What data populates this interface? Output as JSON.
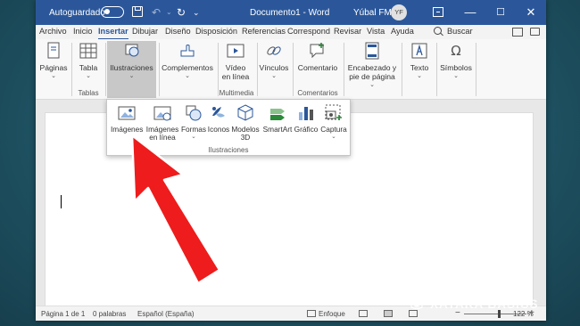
{
  "titlebar": {
    "autosave_label": "Autoguardado",
    "document_title": "Documento1 - Word",
    "user_name": "Yúbal FM",
    "user_initials": "YF",
    "minimize": "—",
    "maximize": "☐",
    "close": "✕"
  },
  "tabs": [
    "Archivo",
    "Inicio",
    "Insertar",
    "Dibujar",
    "Diseño",
    "Disposición",
    "Referencias",
    "Correspondencia",
    "Revisar",
    "Vista",
    "Ayuda"
  ],
  "tab_labels": {
    "archivo": "Archivo",
    "inicio": "Inicio",
    "insertar": "Insertar",
    "dibujar": "Dibujar",
    "diseno": "Diseño",
    "disposicion": "Disposición",
    "referencias": "Referencias",
    "correspondencia": "Correspondencia",
    "revisar": "Revisar",
    "vista": "Vista",
    "ayuda": "Ayuda",
    "buscar": "Buscar"
  },
  "active_tab": "Insertar",
  "ribbon": {
    "paginas": "Páginas",
    "tabla": "Tabla",
    "ilustraciones": "Ilustraciones",
    "complementos": "Complementos",
    "video_l1": "Vídeo",
    "video_l2": "en línea",
    "vinculos": "Vínculos",
    "comentario": "Comentario",
    "encabezado_l1": "Encabezado y",
    "encabezado_l2": "pie de página",
    "texto": "Texto",
    "simbolos": "Símbolos",
    "group_tablas": "Tablas",
    "group_multimedia": "Multimedia",
    "group_comentarios": "Comentarios"
  },
  "dropdown": {
    "imagenes": "Imágenes",
    "imagenes_linea_l1": "Imágenes",
    "imagenes_linea_l2": "en línea",
    "formas": "Formas",
    "iconos": "Iconos",
    "modelos_l1": "Modelos",
    "modelos_l2": "3D",
    "smartart": "SmartArt",
    "grafico": "Gráfico",
    "captura": "Captura",
    "group_label": "Ilustraciones"
  },
  "statusbar": {
    "page": "Página 1 de 1",
    "words": "0 palabras",
    "language": "Español (España)",
    "focus": "Enfoque",
    "zoom": "122 %"
  },
  "watermark": "XATAKA BASICS",
  "colors": {
    "word_blue": "#2b579a",
    "background": "#1f5465",
    "arrow_red": "#ee1c1c"
  }
}
